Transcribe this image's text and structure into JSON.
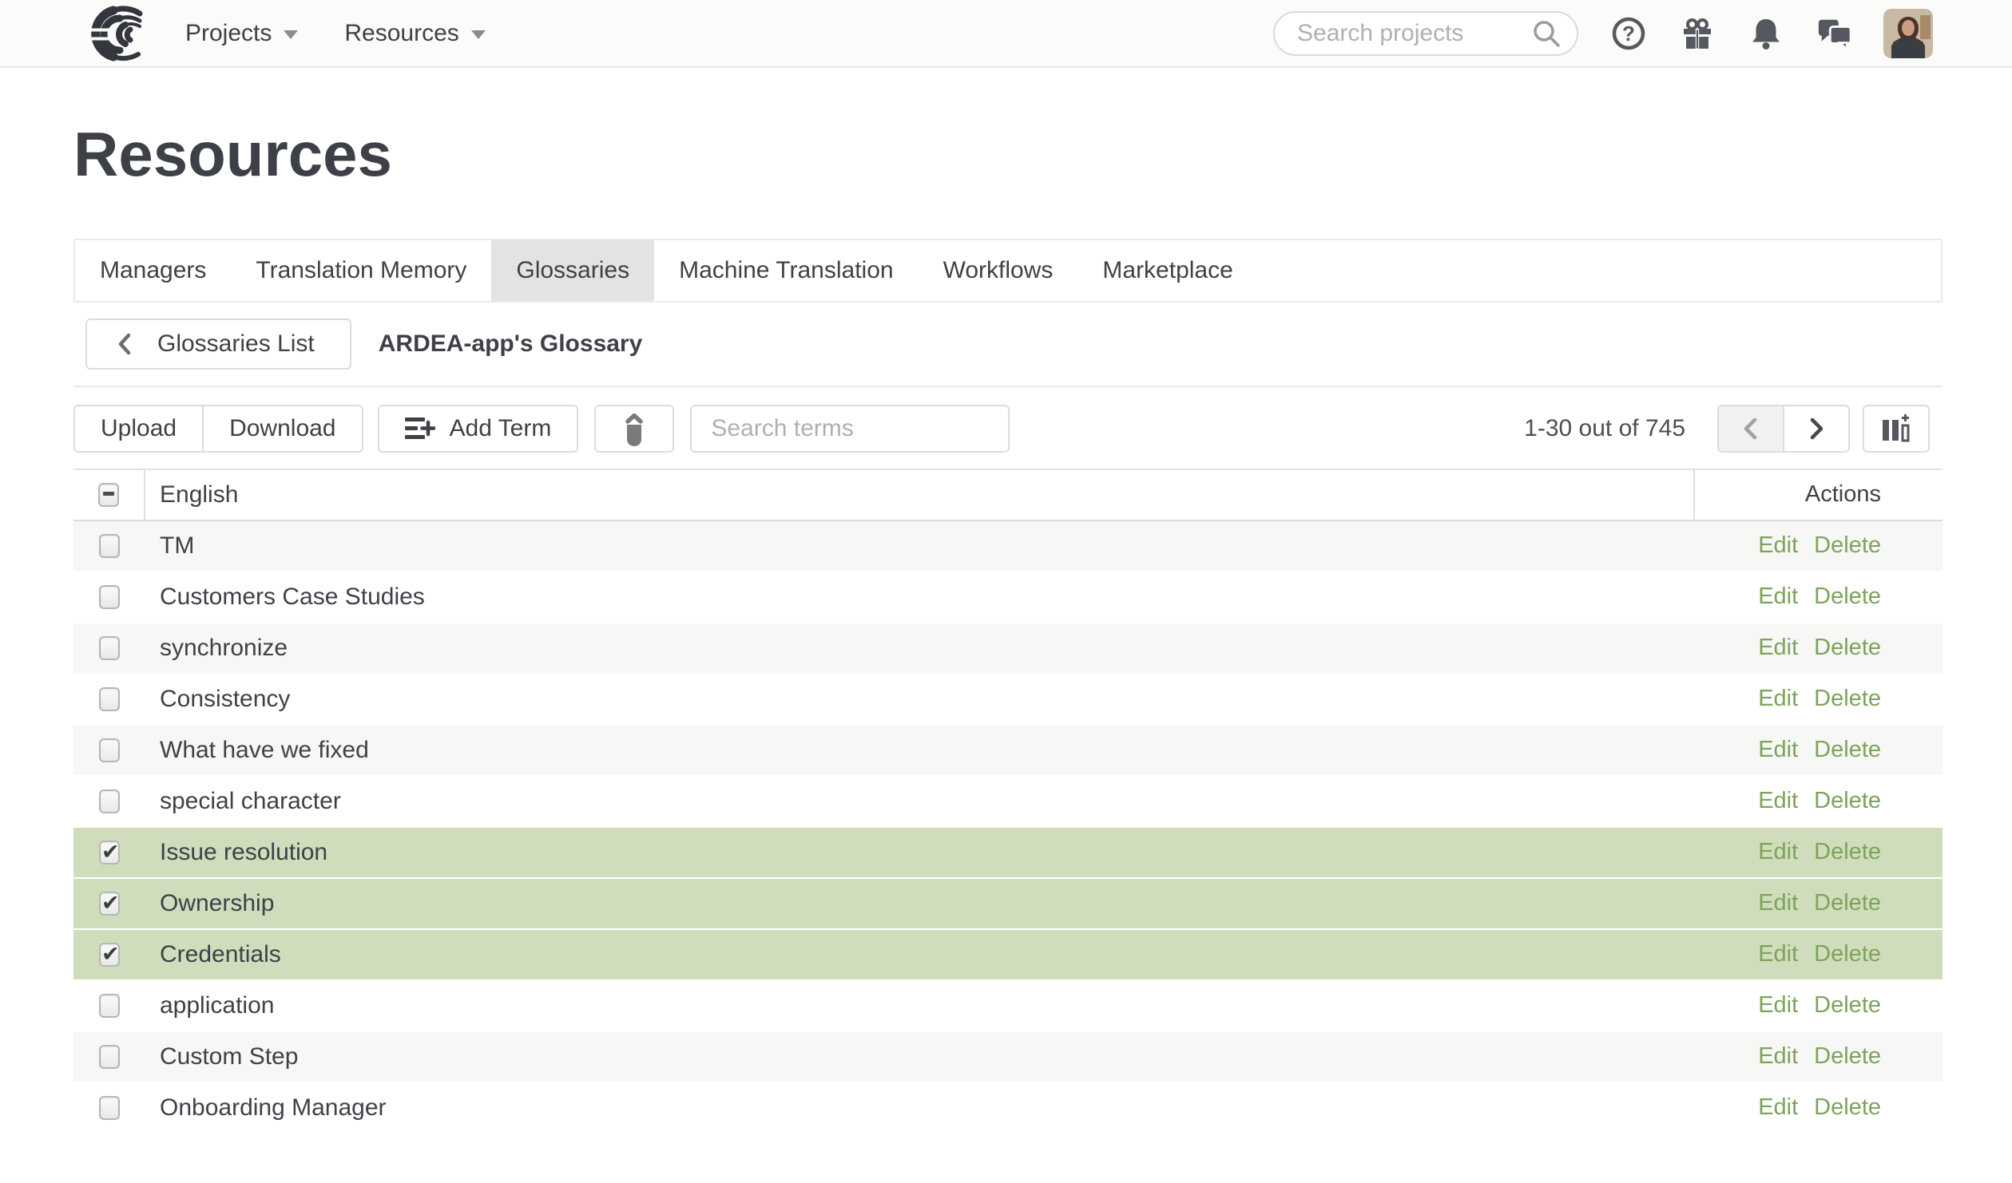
{
  "nav": {
    "logo_name": "wave-logo",
    "menus": [
      {
        "label": "Projects"
      },
      {
        "label": "Resources"
      }
    ],
    "search": {
      "placeholder": "Search projects"
    },
    "icon_names": [
      "help-icon",
      "gift-icon",
      "bell-icon",
      "chat-icon",
      "avatar"
    ]
  },
  "page": {
    "title": "Resources"
  },
  "tabs": [
    {
      "label": "Managers",
      "active": false
    },
    {
      "label": "Translation Memory",
      "active": false
    },
    {
      "label": "Glossaries",
      "active": true
    },
    {
      "label": "Machine Translation",
      "active": false
    },
    {
      "label": "Workflows",
      "active": false
    },
    {
      "label": "Marketplace",
      "active": false
    }
  ],
  "breadcrumb": {
    "back_label": "Glossaries List",
    "current": "ARDEA-app's Glossary"
  },
  "toolbar": {
    "upload_label": "Upload",
    "download_label": "Download",
    "add_term_label": "Add Term",
    "search_placeholder": "Search terms",
    "pagination_text": "1-30 out of 745"
  },
  "table": {
    "term_column_header": "English",
    "actions_column_header": "Actions",
    "edit_label": "Edit",
    "delete_label": "Delete",
    "rows": [
      {
        "term": "TM",
        "checked": false
      },
      {
        "term": "Customers Case Studies",
        "checked": false
      },
      {
        "term": "synchronize",
        "checked": false
      },
      {
        "term": "Consistency",
        "checked": false
      },
      {
        "term": "What have we fixed",
        "checked": false
      },
      {
        "term": "special character",
        "checked": false
      },
      {
        "term": "Issue resolution",
        "checked": true
      },
      {
        "term": "Ownership",
        "checked": true
      },
      {
        "term": "Credentials",
        "checked": true
      },
      {
        "term": "application",
        "checked": false
      },
      {
        "term": "Custom Step",
        "checked": false
      },
      {
        "term": "Onboarding Manager",
        "checked": false
      }
    ]
  },
  "colors": {
    "accent_green": "#7da35b",
    "selected_row_bg": "#cfddbc",
    "striped_row_bg": "#f7f7f5",
    "active_tab_bg": "#e4e3e1",
    "text": "#3e4147"
  }
}
